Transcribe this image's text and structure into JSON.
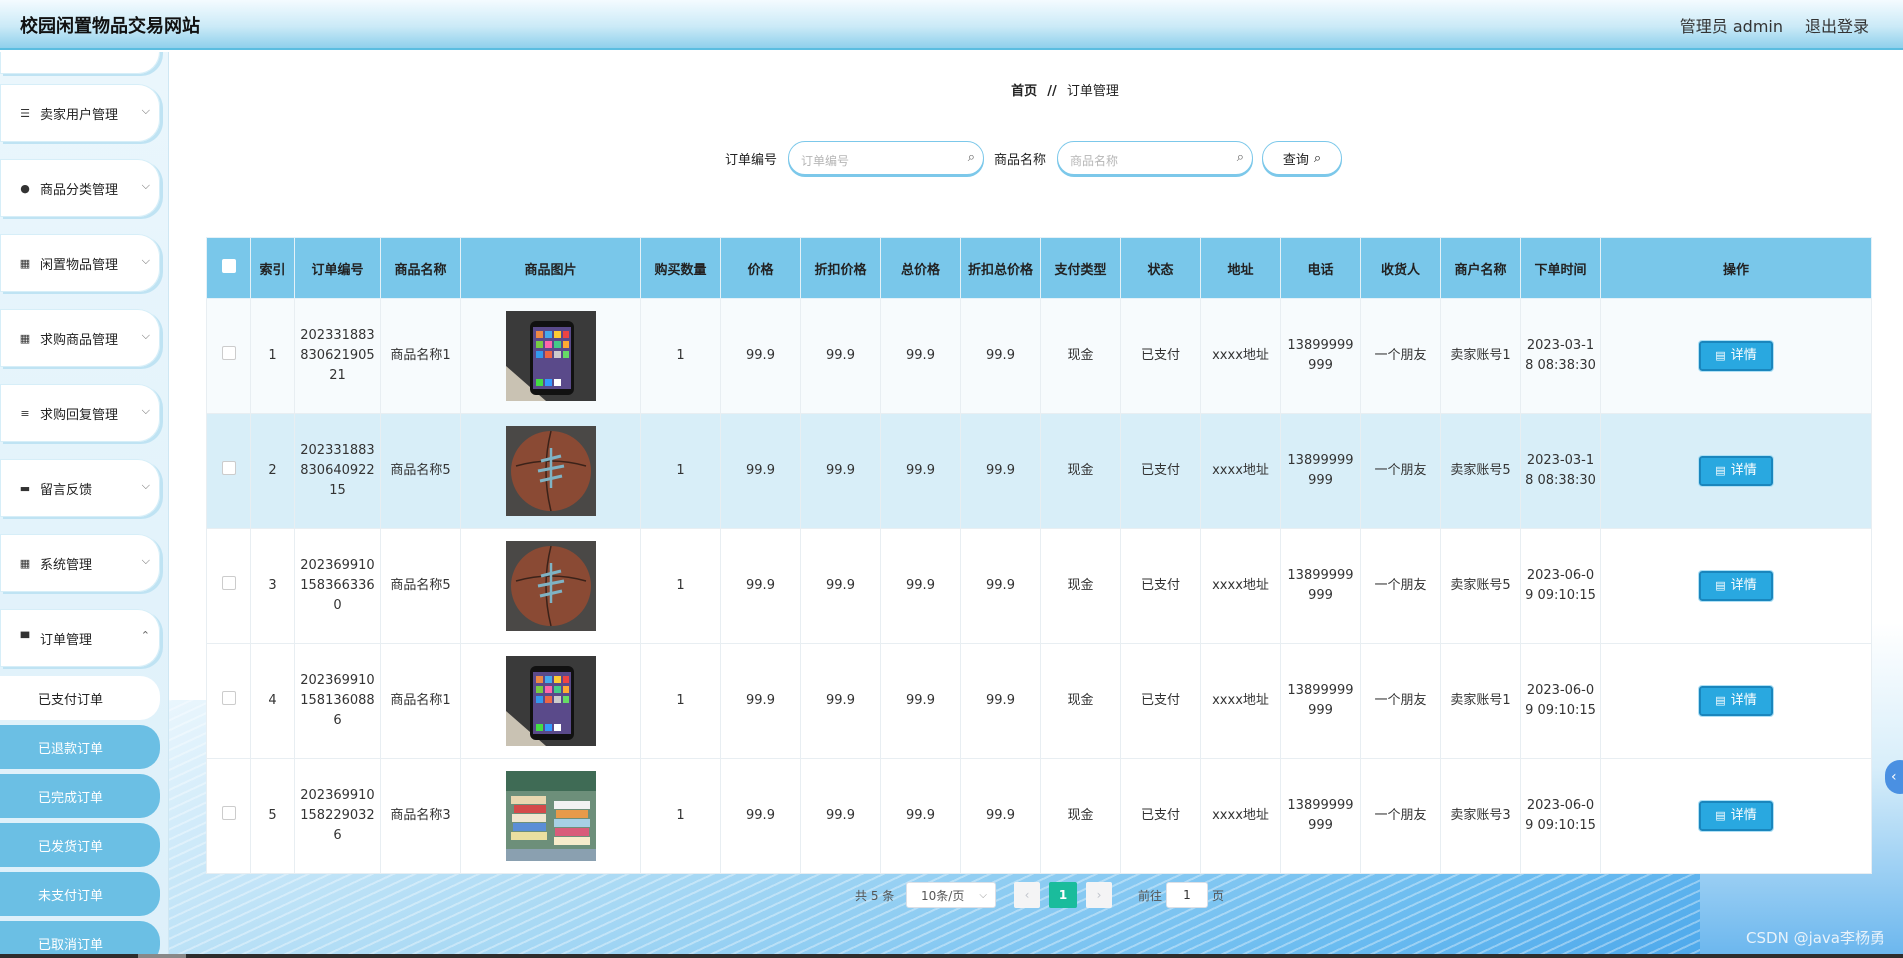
{
  "header": {
    "title": "校园闲置物品交易网站",
    "admin": "管理员 admin",
    "logout": "退出登录"
  },
  "sidebar": {
    "menus": [
      {
        "label": "卖家用户管理",
        "icon": "sliders-icon"
      },
      {
        "label": "商品分类管理",
        "icon": "user-icon"
      },
      {
        "label": "闲置物品管理",
        "icon": "grid-icon"
      },
      {
        "label": "求购商品管理",
        "icon": "grid-icon"
      },
      {
        "label": "求购回复管理",
        "icon": "list-icon"
      },
      {
        "label": "留言反馈",
        "icon": "bag-icon"
      },
      {
        "label": "系统管理",
        "icon": "grid-icon"
      },
      {
        "label": "订单管理",
        "icon": "monitor-icon"
      }
    ],
    "submenus": [
      "已支付订单",
      "已退款订单",
      "已完成订单",
      "已发货订单",
      "未支付订单",
      "已取消订单"
    ]
  },
  "breadcrumb": {
    "home": "首页",
    "sep": "//",
    "current": "订单管理"
  },
  "search": {
    "order_no_label": "订单编号",
    "order_no_placeholder": "订单编号",
    "product_name_label": "商品名称",
    "product_name_placeholder": "商品名称",
    "query_label": "查询"
  },
  "table": {
    "headers": [
      "索引",
      "订单编号",
      "商品名称",
      "商品图片",
      "购买数量",
      "价格",
      "折扣价格",
      "总价格",
      "折扣总价格",
      "支付类型",
      "状态",
      "地址",
      "电话",
      "收货人",
      "商户名称",
      "下单时间",
      "操作"
    ],
    "rows": [
      {
        "index": "1",
        "order_no": "20233188383062190521",
        "name": "商品名称1",
        "image": "phone",
        "qty": "1",
        "price": "99.9",
        "disc_price": "99.9",
        "total": "99.9",
        "disc_total": "99.9",
        "pay": "现金",
        "status": "已支付",
        "addr": "xxxx地址",
        "phone": "13899999999",
        "receiver": "一个朋友",
        "merchant": "卖家账号1",
        "time": "2023-03-18 08:38:30",
        "action": "详情"
      },
      {
        "index": "2",
        "order_no": "20233188383064092215",
        "name": "商品名称5",
        "image": "basketball",
        "qty": "1",
        "price": "99.9",
        "disc_price": "99.9",
        "total": "99.9",
        "disc_total": "99.9",
        "pay": "现金",
        "status": "已支付",
        "addr": "xxxx地址",
        "phone": "13899999999",
        "receiver": "一个朋友",
        "merchant": "卖家账号5",
        "time": "2023-03-18 08:38:30",
        "action": "详情"
      },
      {
        "index": "3",
        "order_no": "2023699101583663360",
        "name": "商品名称5",
        "image": "basketball",
        "qty": "1",
        "price": "99.9",
        "disc_price": "99.9",
        "total": "99.9",
        "disc_total": "99.9",
        "pay": "现金",
        "status": "已支付",
        "addr": "xxxx地址",
        "phone": "13899999999",
        "receiver": "一个朋友",
        "merchant": "卖家账号5",
        "time": "2023-06-09 09:10:15",
        "action": "详情"
      },
      {
        "index": "4",
        "order_no": "2023699101581360886",
        "name": "商品名称1",
        "image": "phone",
        "qty": "1",
        "price": "99.9",
        "disc_price": "99.9",
        "total": "99.9",
        "disc_total": "99.9",
        "pay": "现金",
        "status": "已支付",
        "addr": "xxxx地址",
        "phone": "13899999999",
        "receiver": "一个朋友",
        "merchant": "卖家账号1",
        "time": "2023-06-09 09:10:15",
        "action": "详情"
      },
      {
        "index": "5",
        "order_no": "2023699101582290326",
        "name": "商品名称3",
        "image": "books",
        "qty": "1",
        "price": "99.9",
        "disc_price": "99.9",
        "total": "99.9",
        "disc_total": "99.9",
        "pay": "现金",
        "status": "已支付",
        "addr": "xxxx地址",
        "phone": "13899999999",
        "receiver": "一个朋友",
        "merchant": "卖家账号3",
        "time": "2023-06-09 09:10:15",
        "action": "详情"
      }
    ]
  },
  "pagination": {
    "total": "共 5 条",
    "page_size": "10条/页",
    "prev": "‹",
    "current": "1",
    "next": "›",
    "goto_label": "前往",
    "goto_value": "1",
    "page_unit": "页"
  },
  "watermark": "CSDN @java李杨勇",
  "colors": {
    "accent": "#79c7ea",
    "button": "#29a8e0",
    "current_page": "#1abc9c"
  }
}
